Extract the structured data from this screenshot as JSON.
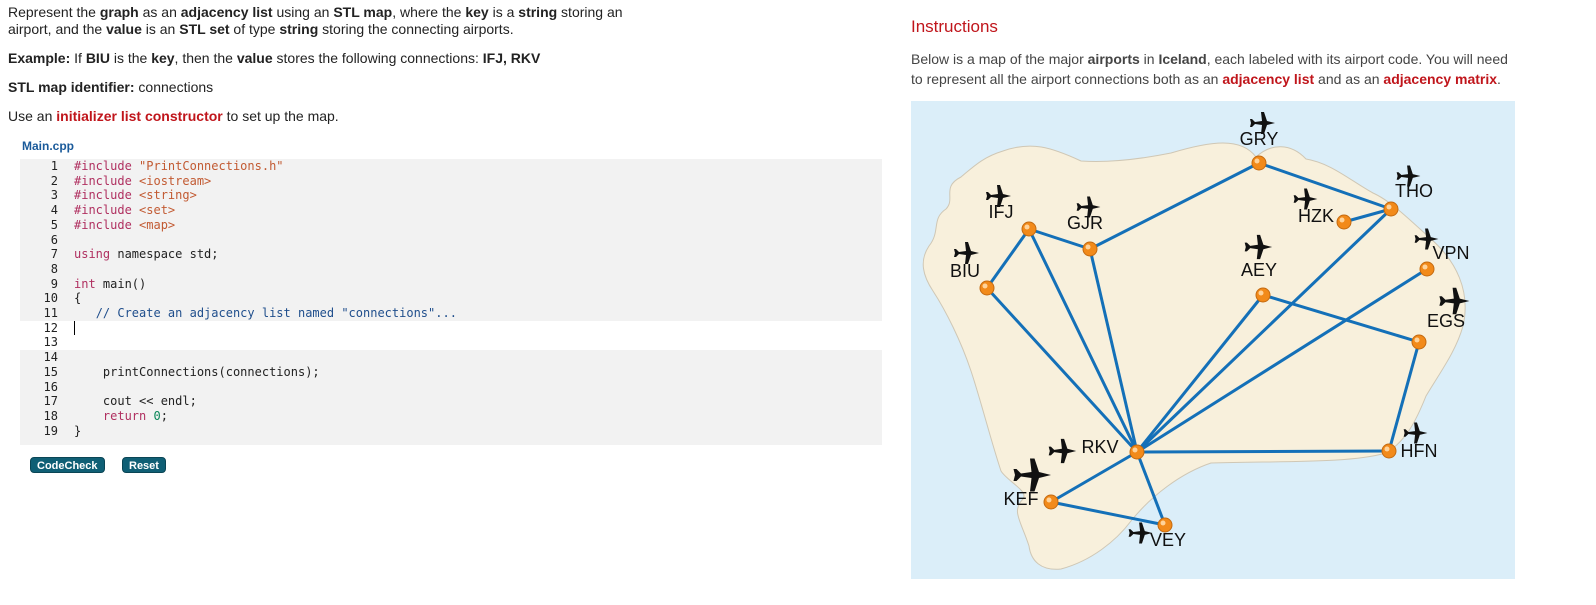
{
  "problem": {
    "p1": [
      "Represent the ",
      "graph",
      " as an ",
      "adjacency list",
      " using an ",
      "STL map",
      ", where the ",
      "key",
      " is a ",
      "string",
      " storing an airport, and the ",
      "value",
      " is an ",
      "STL set",
      " of type ",
      "string",
      " storing the connecting airports."
    ],
    "example_label": "Example:",
    "example_text_1": " If ",
    "example_key_airport": "BIU",
    "example_text_2": " is the ",
    "example_key": "key",
    "example_text_3": ", then the ",
    "example_value": "value",
    "example_text_4": " stores the following connections: ",
    "example_connections": "IFJ, RKV",
    "identifier_label": "STL map identifier:",
    "identifier_value": " connections",
    "use_prefix": "Use an ",
    "use_highlight": "initializer list constructor",
    "use_suffix": " to set up the map."
  },
  "editor": {
    "filename": "Main.cpp",
    "lines": [
      {
        "n": "1",
        "tokens": [
          [
            "kw",
            "#include "
          ],
          [
            "str",
            "\"PrintConnections.h\""
          ]
        ]
      },
      {
        "n": "2",
        "tokens": [
          [
            "kw",
            "#include "
          ],
          [
            "str",
            "<iostream>"
          ]
        ]
      },
      {
        "n": "3",
        "tokens": [
          [
            "kw",
            "#include "
          ],
          [
            "str",
            "<string>"
          ]
        ]
      },
      {
        "n": "4",
        "tokens": [
          [
            "kw",
            "#include "
          ],
          [
            "str",
            "<set>"
          ]
        ]
      },
      {
        "n": "5",
        "tokens": [
          [
            "kw",
            "#include "
          ],
          [
            "str",
            "<map>"
          ]
        ]
      },
      {
        "n": "6",
        "tokens": []
      },
      {
        "n": "7",
        "tokens": [
          [
            "kw",
            "using "
          ],
          [
            "",
            "namespace std;"
          ]
        ]
      },
      {
        "n": "8",
        "tokens": []
      },
      {
        "n": "9",
        "tokens": [
          [
            "kw",
            "int "
          ],
          [
            "",
            "main()"
          ]
        ]
      },
      {
        "n": "10",
        "tokens": [
          [
            "",
            "{"
          ]
        ]
      },
      {
        "n": "11",
        "tokens": [
          [
            "",
            "   "
          ],
          [
            "cm",
            "// Create an adjacency list named \"connections\"..."
          ]
        ]
      },
      {
        "n": "12",
        "tokens": [],
        "editable": true
      },
      {
        "n": "13",
        "tokens": [],
        "editable": true
      },
      {
        "n": "14",
        "tokens": []
      },
      {
        "n": "15",
        "tokens": [
          [
            "",
            "    printConnections(connections);"
          ]
        ]
      },
      {
        "n": "16",
        "tokens": []
      },
      {
        "n": "17",
        "tokens": [
          [
            "",
            "    cout << endl;"
          ]
        ]
      },
      {
        "n": "18",
        "tokens": [
          [
            "",
            "    "
          ],
          [
            "kw",
            "return "
          ],
          [
            "num",
            "0"
          ],
          [
            "",
            ";"
          ]
        ]
      },
      {
        "n": "19",
        "tokens": [
          [
            "",
            "}"
          ]
        ]
      }
    ]
  },
  "buttons": {
    "codecheck": "CodeCheck",
    "reset": "Reset"
  },
  "instructions": {
    "title": "Instructions",
    "t1": "Below is a map of the major ",
    "t2": "airports",
    "t3": " in ",
    "t4": "Iceland",
    "t5": ", each labeled with its airport code. You will need to represent all the airport connections both as an ",
    "t6": "adjacency list",
    "t7": " and as an ",
    "t8": "adjacency matrix",
    "t9": "."
  },
  "map": {
    "colors": {
      "water": "#dbeef9",
      "land": "#f8f0dc",
      "edge": "#1470b8",
      "node": "#f28a1a",
      "text": "#111"
    },
    "airports": [
      "GRY",
      "THO",
      "HZK",
      "IFJ",
      "GJR",
      "AEY",
      "VPN",
      "BIU",
      "EGS",
      "RKV",
      "HFN",
      "KEF",
      "VEY"
    ],
    "connections": [
      [
        "BIU",
        "IFJ"
      ],
      [
        "BIU",
        "RKV"
      ],
      [
        "IFJ",
        "GJR"
      ],
      [
        "IFJ",
        "RKV"
      ],
      [
        "GJR",
        "GRY"
      ],
      [
        "GJR",
        "RKV"
      ],
      [
        "GRY",
        "THO"
      ],
      [
        "HZK",
        "THO"
      ],
      [
        "THO",
        "RKV"
      ],
      [
        "AEY",
        "EGS"
      ],
      [
        "AEY",
        "RKV"
      ],
      [
        "VPN",
        "RKV"
      ],
      [
        "EGS",
        "HFN"
      ],
      [
        "RKV",
        "HFN"
      ],
      [
        "RKV",
        "KEF"
      ],
      [
        "RKV",
        "VEY"
      ],
      [
        "KEF",
        "VEY"
      ]
    ]
  }
}
